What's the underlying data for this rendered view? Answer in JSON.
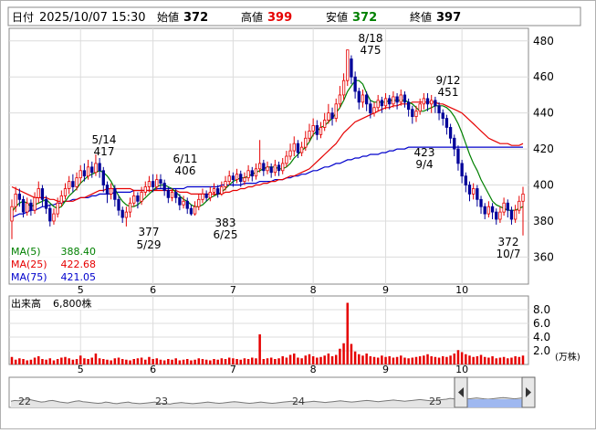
{
  "header": {
    "date_label": "日付",
    "datetime": "2025/10/07 15:30",
    "open_label": "始値",
    "open": "372",
    "high_label": "高値",
    "high": "399",
    "low_label": "安値",
    "low": "372",
    "close_label": "終値",
    "close": "397"
  },
  "colors": {
    "up": "#e60000",
    "down": "#000099",
    "ma5": "#008000",
    "ma25": "#e60000",
    "ma75": "#0000cc",
    "volume": "#e60000",
    "high": "#e60000",
    "low": "#008000"
  },
  "ma_legend": [
    {
      "label": "MA(5)",
      "value": "388.40"
    },
    {
      "label": "MA(25)",
      "value": "422.68"
    },
    {
      "label": "MA(75)",
      "value": "421.05"
    }
  ],
  "volume_panel": {
    "title": "出来高",
    "value": "6,800株",
    "unit": "(万株)",
    "ticks": [
      "8.0",
      "6.0",
      "4.0",
      "2.0"
    ]
  },
  "price_ticks": [
    "480",
    "460",
    "440",
    "420",
    "400",
    "380",
    "360"
  ],
  "month_labels": [
    "5",
    "6",
    "7",
    "8",
    "9",
    "10"
  ],
  "navigator": {
    "labels": [
      "22",
      "23",
      "24",
      "25"
    ]
  },
  "annotations": [
    {
      "date": "5/14",
      "value": "417"
    },
    {
      "date": "6/11",
      "value": "406"
    },
    {
      "date": "5/29",
      "value": "377"
    },
    {
      "date": "6/25",
      "value": "383"
    },
    {
      "date": "8/18",
      "value": "475"
    },
    {
      "date": "9/12",
      "value": "451"
    },
    {
      "date": "9/4",
      "value": "423"
    },
    {
      "date": "10/7",
      "value": "372"
    }
  ],
  "chart_data": {
    "type": "candlestick",
    "ylim": [
      345,
      487
    ],
    "volume_ylim": [
      0,
      10
    ],
    "n_days": 135,
    "month_starts": [
      {
        "label": "5",
        "index": 18
      },
      {
        "label": "6",
        "index": 37
      },
      {
        "label": "7",
        "index": 58
      },
      {
        "label": "8",
        "index": 79
      },
      {
        "label": "9",
        "index": 98
      },
      {
        "label": "10",
        "index": 118
      }
    ],
    "candles": [
      [
        380,
        388,
        392,
        370
      ],
      [
        388,
        395,
        399,
        385
      ],
      [
        395,
        392,
        398,
        388
      ],
      [
        392,
        385,
        394,
        382
      ],
      [
        385,
        390,
        393,
        383
      ],
      [
        390,
        386,
        392,
        383
      ],
      [
        386,
        393,
        396,
        384
      ],
      [
        393,
        398,
        402,
        390
      ],
      [
        398,
        392,
        400,
        388
      ],
      [
        392,
        387,
        394,
        384
      ],
      [
        387,
        380,
        389,
        377
      ],
      [
        380,
        384,
        387,
        378
      ],
      [
        384,
        390,
        393,
        382
      ],
      [
        390,
        394,
        397,
        388
      ],
      [
        394,
        398,
        401,
        392
      ],
      [
        398,
        402,
        405,
        395
      ],
      [
        402,
        399,
        406,
        396
      ],
      [
        399,
        404,
        407,
        397
      ],
      [
        404,
        408,
        411,
        401
      ],
      [
        408,
        405,
        412,
        402
      ],
      [
        405,
        410,
        414,
        403
      ],
      [
        410,
        407,
        413,
        404
      ],
      [
        407,
        412,
        417,
        405
      ],
      [
        412,
        408,
        415,
        404
      ],
      [
        408,
        400,
        410,
        396
      ],
      [
        400,
        395,
        402,
        390
      ],
      [
        395,
        398,
        401,
        392
      ],
      [
        398,
        392,
        400,
        388
      ],
      [
        392,
        386,
        394,
        383
      ],
      [
        386,
        382,
        388,
        379
      ],
      [
        382,
        385,
        388,
        377
      ],
      [
        385,
        390,
        393,
        382
      ],
      [
        390,
        394,
        397,
        388
      ],
      [
        394,
        391,
        396,
        387
      ],
      [
        391,
        396,
        399,
        389
      ],
      [
        396,
        399,
        402,
        394
      ],
      [
        399,
        402,
        405,
        396
      ],
      [
        402,
        399,
        406,
        396
      ],
      [
        399,
        403,
        406,
        397
      ],
      [
        403,
        401,
        406,
        398
      ],
      [
        401,
        397,
        403,
        394
      ],
      [
        397,
        393,
        399,
        390
      ],
      [
        393,
        396,
        398,
        391
      ],
      [
        396,
        393,
        398,
        390
      ],
      [
        393,
        389,
        395,
        386
      ],
      [
        389,
        391,
        394,
        387
      ],
      [
        391,
        387,
        393,
        384
      ],
      [
        387,
        384,
        389,
        383
      ],
      [
        384,
        388,
        391,
        383
      ],
      [
        388,
        392,
        395,
        386
      ],
      [
        392,
        395,
        398,
        390
      ],
      [
        395,
        393,
        397,
        391
      ],
      [
        393,
        396,
        399,
        391
      ],
      [
        396,
        398,
        401,
        394
      ],
      [
        398,
        395,
        400,
        393
      ],
      [
        395,
        399,
        402,
        394
      ],
      [
        399,
        402,
        405,
        397
      ],
      [
        402,
        405,
        408,
        400
      ],
      [
        405,
        403,
        407,
        399
      ],
      [
        403,
        406,
        409,
        401
      ],
      [
        406,
        402,
        408,
        399
      ],
      [
        402,
        404,
        407,
        400
      ],
      [
        404,
        408,
        411,
        402
      ],
      [
        408,
        405,
        410,
        402
      ],
      [
        405,
        409,
        412,
        403
      ],
      [
        409,
        412,
        425,
        407
      ],
      [
        412,
        408,
        414,
        405
      ],
      [
        408,
        410,
        413,
        406
      ],
      [
        410,
        407,
        412,
        404
      ],
      [
        407,
        411,
        414,
        405
      ],
      [
        411,
        408,
        413,
        405
      ],
      [
        408,
        412,
        415,
        406
      ],
      [
        412,
        416,
        419,
        410
      ],
      [
        416,
        419,
        423,
        414
      ],
      [
        419,
        423,
        427,
        416
      ],
      [
        423,
        418,
        425,
        415
      ],
      [
        418,
        421,
        424,
        416
      ],
      [
        421,
        426,
        430,
        419
      ],
      [
        426,
        430,
        434,
        424
      ],
      [
        430,
        433,
        437,
        427
      ],
      [
        433,
        428,
        436,
        425
      ],
      [
        428,
        432,
        435,
        426
      ],
      [
        432,
        436,
        440,
        430
      ],
      [
        436,
        440,
        445,
        434
      ],
      [
        440,
        437,
        443,
        433
      ],
      [
        437,
        445,
        448,
        435
      ],
      [
        445,
        450,
        455,
        443
      ],
      [
        450,
        458,
        462,
        447
      ],
      [
        458,
        475,
        475,
        455
      ],
      [
        470,
        460,
        472,
        456
      ],
      [
        460,
        452,
        463,
        448
      ],
      [
        452,
        446,
        454,
        442
      ],
      [
        446,
        450,
        453,
        443
      ],
      [
        450,
        445,
        452,
        441
      ],
      [
        445,
        440,
        447,
        437
      ],
      [
        440,
        443,
        446,
        438
      ],
      [
        443,
        447,
        450,
        441
      ],
      [
        447,
        444,
        449,
        440
      ],
      [
        444,
        448,
        451,
        442
      ],
      [
        448,
        445,
        450,
        442
      ],
      [
        445,
        449,
        452,
        443
      ],
      [
        449,
        446,
        451,
        442
      ],
      [
        446,
        450,
        453,
        444
      ],
      [
        450,
        446,
        452,
        443
      ],
      [
        446,
        442,
        448,
        438
      ],
      [
        442,
        438,
        444,
        434
      ],
      [
        438,
        441,
        444,
        435
      ],
      [
        441,
        445,
        448,
        439
      ],
      [
        445,
        448,
        451,
        442
      ],
      [
        448,
        445,
        451,
        441
      ],
      [
        445,
        447,
        450,
        440
      ],
      [
        447,
        444,
        449,
        440
      ],
      [
        444,
        440,
        446,
        436
      ],
      [
        440,
        437,
        442,
        433
      ],
      [
        437,
        432,
        439,
        428
      ],
      [
        432,
        426,
        434,
        423
      ],
      [
        426,
        420,
        428,
        416
      ],
      [
        420,
        412,
        422,
        408
      ],
      [
        412,
        405,
        414,
        401
      ],
      [
        405,
        400,
        407,
        396
      ],
      [
        400,
        395,
        402,
        391
      ],
      [
        395,
        398,
        401,
        392
      ],
      [
        398,
        392,
        400,
        388
      ],
      [
        392,
        388,
        394,
        384
      ],
      [
        388,
        384,
        390,
        381
      ],
      [
        384,
        388,
        391,
        382
      ],
      [
        388,
        385,
        390,
        381
      ],
      [
        385,
        381,
        387,
        378
      ],
      [
        381,
        385,
        388,
        379
      ],
      [
        385,
        390,
        393,
        383
      ],
      [
        390,
        386,
        392,
        382
      ],
      [
        386,
        381,
        388,
        378
      ],
      [
        381,
        386,
        389,
        379
      ],
      [
        386,
        391,
        394,
        384
      ],
      [
        391,
        395,
        399,
        372
      ]
    ],
    "volume": [
      1.1,
      0.7,
      0.9,
      0.8,
      0.6,
      0.7,
      1.0,
      1.2,
      0.8,
      0.7,
      0.9,
      0.6,
      0.8,
      1.0,
      1.1,
      0.9,
      0.7,
      0.8,
      1.3,
      0.9,
      0.8,
      1.0,
      1.6,
      0.9,
      0.8,
      0.7,
      0.6,
      0.9,
      1.0,
      0.8,
      0.7,
      0.6,
      0.8,
      0.9,
      1.0,
      0.7,
      1.1,
      0.8,
      0.9,
      0.7,
      0.6,
      0.8,
      0.7,
      0.9,
      0.6,
      0.7,
      0.8,
      0.6,
      0.7,
      0.9,
      0.8,
      0.7,
      0.6,
      0.8,
      0.7,
      0.9,
      0.8,
      1.0,
      0.9,
      0.8,
      0.7,
      0.9,
      0.8,
      1.0,
      0.9,
      4.4,
      0.8,
      0.9,
      1.0,
      0.8,
      0.9,
      1.2,
      1.0,
      1.4,
      1.6,
      1.0,
      0.9,
      1.3,
      1.5,
      1.2,
      1.0,
      1.1,
      1.3,
      1.6,
      1.2,
      1.4,
      2.3,
      3.1,
      9.0,
      3.0,
      1.9,
      1.5,
      1.3,
      1.6,
      1.2,
      1.1,
      1.0,
      1.3,
      1.1,
      1.2,
      1.0,
      1.1,
      1.3,
      1.0,
      0.9,
      1.0,
      1.1,
      1.2,
      1.3,
      1.5,
      1.2,
      1.1,
      1.0,
      1.2,
      1.1,
      1.3,
      1.6,
      2.1,
      1.8,
      1.5,
      1.3,
      1.1,
      1.2,
      1.4,
      1.1,
      1.0,
      1.2,
      0.9,
      1.0,
      1.1,
      0.9,
      1.0,
      1.2,
      1.1,
      1.3
    ],
    "ma5": [
      385,
      388,
      390,
      391,
      390,
      388,
      389,
      390,
      391,
      392,
      390,
      388,
      387,
      388,
      391,
      394,
      396,
      398,
      401,
      403,
      405,
      406,
      407,
      408,
      407,
      405,
      402,
      398,
      394,
      391,
      389,
      388,
      388,
      389,
      391,
      393,
      395,
      397,
      399,
      400,
      400,
      399,
      398,
      396,
      394,
      392,
      391,
      389,
      388,
      388,
      389,
      391,
      393,
      394,
      395,
      396,
      398,
      400,
      402,
      403,
      404,
      404,
      405,
      406,
      407,
      408,
      409,
      410,
      410,
      410,
      409,
      409,
      410,
      412,
      415,
      417,
      419,
      421,
      424,
      428,
      430,
      432,
      433,
      435,
      437,
      440,
      443,
      447,
      452,
      455,
      458,
      458,
      456,
      451,
      447,
      446,
      446,
      446,
      446,
      447,
      447,
      447,
      447,
      447,
      446,
      445,
      443,
      441,
      441,
      442,
      443,
      444,
      444,
      444,
      443,
      441,
      438,
      434,
      429,
      423,
      417,
      412,
      408,
      403,
      399,
      395,
      391,
      389,
      388,
      387,
      386,
      386,
      386,
      387,
      388
    ],
    "ma25": [
      399,
      398,
      397,
      396,
      395,
      394,
      393,
      393,
      393,
      393,
      392,
      392,
      391,
      391,
      391,
      391,
      391,
      392,
      393,
      393,
      394,
      395,
      396,
      397,
      397,
      398,
      398,
      398,
      398,
      398,
      398,
      398,
      397,
      397,
      397,
      397,
      397,
      397,
      397,
      397,
      397,
      397,
      397,
      397,
      396,
      396,
      396,
      395,
      395,
      395,
      395,
      395,
      395,
      395,
      395,
      395,
      396,
      396,
      397,
      397,
      398,
      398,
      399,
      399,
      400,
      400,
      401,
      401,
      402,
      402,
      403,
      403,
      404,
      405,
      405,
      406,
      407,
      408,
      409,
      411,
      413,
      415,
      417,
      419,
      421,
      423,
      426,
      429,
      431,
      433,
      435,
      436,
      437,
      438,
      439,
      440,
      441,
      442,
      443,
      443,
      444,
      444,
      445,
      445,
      445,
      446,
      446,
      446,
      446,
      446,
      446,
      446,
      445,
      445,
      444,
      443,
      442,
      441,
      440,
      438,
      436,
      434,
      432,
      430,
      428,
      426,
      425,
      424,
      423,
      423,
      423,
      422,
      422,
      422,
      423
    ],
    "ma75": [
      382,
      383,
      384,
      384,
      385,
      386,
      386,
      387,
      388,
      388,
      389,
      389,
      390,
      390,
      391,
      391,
      392,
      392,
      393,
      393,
      393,
      394,
      394,
      395,
      395,
      395,
      395,
      396,
      396,
      396,
      396,
      396,
      397,
      397,
      397,
      397,
      397,
      397,
      398,
      398,
      398,
      398,
      398,
      398,
      398,
      398,
      399,
      399,
      399,
      399,
      399,
      399,
      399,
      399,
      399,
      400,
      400,
      400,
      400,
      400,
      400,
      401,
      401,
      401,
      401,
      402,
      402,
      402,
      402,
      403,
      403,
      403,
      404,
      404,
      405,
      405,
      406,
      406,
      407,
      408,
      408,
      409,
      410,
      410,
      411,
      412,
      412,
      413,
      414,
      414,
      415,
      415,
      416,
      416,
      417,
      417,
      417,
      418,
      418,
      419,
      419,
      420,
      420,
      420,
      421,
      421,
      421,
      421,
      421,
      421,
      421,
      421,
      421,
      421,
      421,
      421,
      421,
      421,
      421,
      421,
      421,
      421,
      421,
      421,
      421,
      421,
      421,
      421,
      421,
      421,
      421,
      421,
      421,
      421,
      421
    ],
    "navigator_values": [
      40,
      42,
      41,
      43,
      45,
      44,
      42,
      40,
      38,
      39,
      41,
      42,
      40,
      38,
      37,
      36,
      38,
      40,
      41,
      39,
      38,
      37,
      36,
      35,
      36,
      38,
      37,
      35,
      34,
      36,
      37,
      38,
      36,
      35,
      34,
      35,
      36,
      37,
      38,
      36,
      35,
      34,
      33,
      35,
      36,
      37,
      36,
      35,
      34,
      35,
      36,
      37,
      38,
      37,
      36,
      35,
      36,
      37,
      38,
      39,
      38,
      37,
      36,
      35,
      36,
      37,
      38,
      37,
      36,
      35,
      36,
      37,
      38,
      39,
      40,
      39,
      38,
      37,
      38,
      39,
      40,
      39,
      38,
      37,
      38,
      39,
      40,
      41,
      40,
      39,
      38,
      39,
      40,
      41,
      42,
      41,
      40,
      39,
      40,
      41,
      42,
      43,
      42,
      41,
      40,
      41,
      42,
      43,
      44,
      43,
      42,
      41,
      42,
      43,
      44,
      45,
      47,
      46,
      45,
      44,
      45,
      46,
      47,
      48,
      47,
      46,
      45,
      46,
      47,
      48,
      49,
      48,
      47,
      46,
      47,
      48
    ]
  }
}
